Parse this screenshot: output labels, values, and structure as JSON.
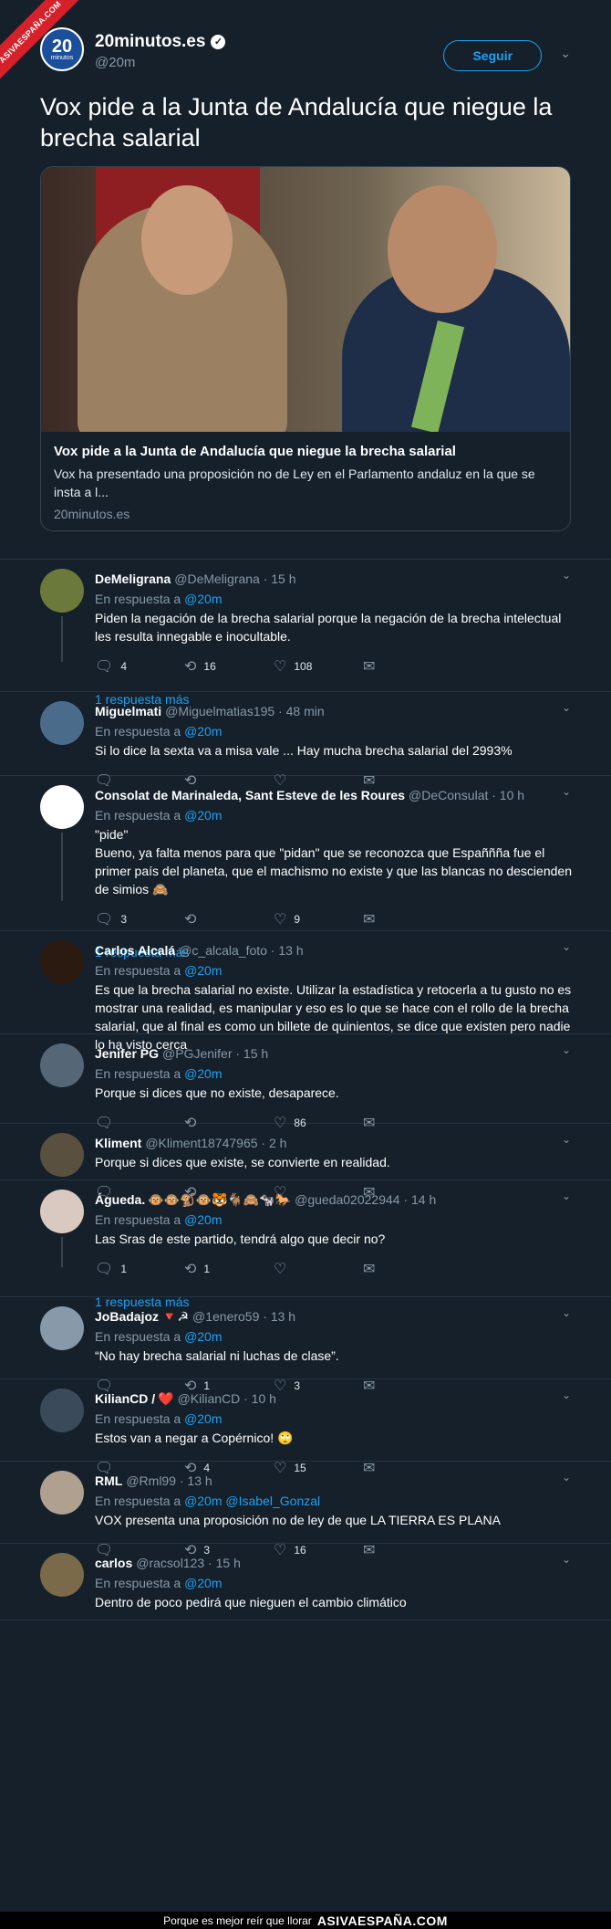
{
  "watermark": {
    "ribbon": "ASIVAESPAÑA.COM",
    "footer_text": "Porque es mejor reír que llorar",
    "footer_brand": "ASIVAESPAÑA.COM"
  },
  "main_tweet": {
    "avatar_number": "20",
    "avatar_word": "minutos",
    "name": "20minutos.es",
    "handle": "@20m",
    "follow_label": "Seguir",
    "text": "Vox pide a la Junta de Andalucía que niegue la brecha salarial",
    "card": {
      "title": "Vox pide a la Junta de Andalucía que niegue la brecha salarial",
      "description": "Vox ha presentado una proposición no de Ley en el Parlamento andaluz en la que se insta a l...",
      "domain": "20minutos.es"
    }
  },
  "in_reply_label": "En respuesta a",
  "more_replies_label": "1 respuesta más",
  "replies": [
    {
      "name": "DeMeligrana",
      "handle": "@DeMeligrana · 15 h",
      "reply_to": "@20m",
      "text": "Piden la negación de la brecha salarial porque la negación de la brecha intelectual les resulta innegable e inocultable.",
      "replies": "4",
      "retweets": "16",
      "likes": "108"
    },
    {
      "name": "Miguelmati",
      "handle": "@Miguelmatias195 · 48 min",
      "reply_to": "@20m",
      "text": "Si lo dice la sexta va a misa  vale ... Hay mucha brecha salarial del 2993%",
      "replies": "",
      "retweets": "",
      "likes": ""
    },
    {
      "name": "Consolat de Marinaleda, Sant Esteve de les Roures",
      "handle": "@DeConsulat · 10 h",
      "reply_to": "@20m",
      "text_lines": [
        "\"pide\"",
        "Bueno, ya falta menos para que \"pidan\" que se reconozca que Españñña fue el primer país del planeta, que el machismo no existe y que las blancas no descienden de simios 🙈"
      ],
      "replies": "3",
      "retweets": "",
      "likes": "9"
    },
    {
      "name": "Carlos Alcalá",
      "handle": "@c_alcala_foto · 13 h",
      "reply_to": "@20m",
      "text": "Es que la brecha salarial no existe. Utilizar la estadística y retocerla a tu gusto no es mostrar una realidad, es manipular y eso es lo que se hace con el rollo de la brecha salarial, que al final es como un billete de quinientos, se dice que existen pero nadie lo ha visto cerca"
    },
    {
      "name": "Jenifer PG",
      "handle": "@PGJenifer · 15 h",
      "reply_to": "@20m",
      "text": "Porque si dices que no existe, desaparece.",
      "replies": "",
      "retweets": "",
      "likes": "86"
    },
    {
      "name": "Kliment",
      "handle": "@Kliment18747965 · 2 h",
      "text": "Porque si dices que existe, se convierte en realidad.",
      "replies": "",
      "retweets": "",
      "likes": ""
    },
    {
      "name": "Águeda.",
      "name_emoji": "🐵🐵🐒🐵🐯🐐🙈🐄🐎",
      "handle": "@gueda02022944 · 14 h",
      "reply_to": "@20m",
      "text": "Las Sras de este partido, tendrá algo que decir no?",
      "replies": "1",
      "retweets": "1",
      "likes": ""
    },
    {
      "name": "JoBadajoz",
      "name_emoji": "🔻☭",
      "handle": "@1enero59 · 13 h",
      "reply_to": "@20m",
      "text": "“No hay brecha salarial ni luchas de clase”.",
      "replies": "",
      "retweets": "1",
      "likes": "3"
    },
    {
      "name": "KilianCD /",
      "name_emoji": "❤️",
      "handle": "@KilianCD · 10 h",
      "reply_to": "@20m",
      "text": "Estos van a negar a Copérnico! 🙄",
      "replies": "",
      "retweets": "4",
      "likes": "15"
    },
    {
      "name": "RML",
      "handle": "@Rml99 · 13 h",
      "reply_to": "@20m",
      "reply_to_2": "@Isabel_Gonzal",
      "text": "VOX presenta una proposición no de ley de que LA TIERRA ES PLANA",
      "replies": "",
      "retweets": "3",
      "likes": "16"
    },
    {
      "name": "carlos",
      "handle": "@racsol123 · 15 h",
      "reply_to": "@20m",
      "text": "Dentro de poco pedirá que nieguen el cambio climático"
    }
  ],
  "icons": {
    "reply": "reply-icon",
    "retweet": "retweet-icon",
    "like": "heart-icon",
    "dm": "message-icon",
    "more": "chevron-down-icon"
  },
  "colors": {
    "background": "#15202b",
    "link": "#1da1f2",
    "muted": "#8899a6",
    "ribbon": "#d6202a"
  }
}
